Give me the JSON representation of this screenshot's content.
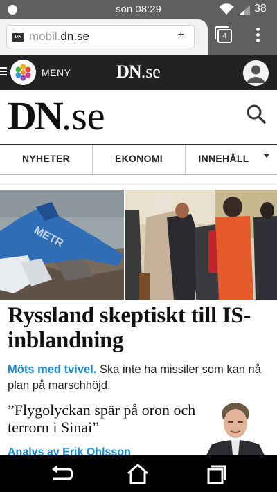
{
  "status_bar": {
    "time": "sön 08:29",
    "battery": "38"
  },
  "browser": {
    "url_prefix": "mobil.",
    "url_host": "dn.se",
    "new_tab_label": "+",
    "tab_count": "4",
    "favicon_text": "DN"
  },
  "site_header": {
    "menu_label": "MENY",
    "logo_bold": "DN",
    "logo_rest": ".se"
  },
  "brand": {
    "logo_bold": "DN",
    "logo_rest": ".se"
  },
  "nav": {
    "items": [
      {
        "label": "NYHETER"
      },
      {
        "label": "EKONOMI"
      },
      {
        "label": "INNEHÅLL"
      }
    ]
  },
  "article": {
    "headline": "Ryssland skeptiskt till IS-inblandning",
    "lead_kicker": "Möts med tvivel.",
    "lead_text": " Ska inte ha missiler som kan nå plan på marschhöjd.",
    "sub_headline": "”Flygolyckan spär på oron och terrorn i Sinai”",
    "byline": "Analys av Erik Ohlsson"
  },
  "colors": {
    "accent": "#1a8ad4",
    "header_bg": "#222222",
    "chrome_bg": "#5d5f61"
  },
  "icons": {
    "search": "search-icon",
    "account": "account-icon",
    "back": "back-icon",
    "home": "home-icon",
    "recents": "recents-icon",
    "tabs": "tabs-icon",
    "overflow": "overflow-menu-icon"
  }
}
